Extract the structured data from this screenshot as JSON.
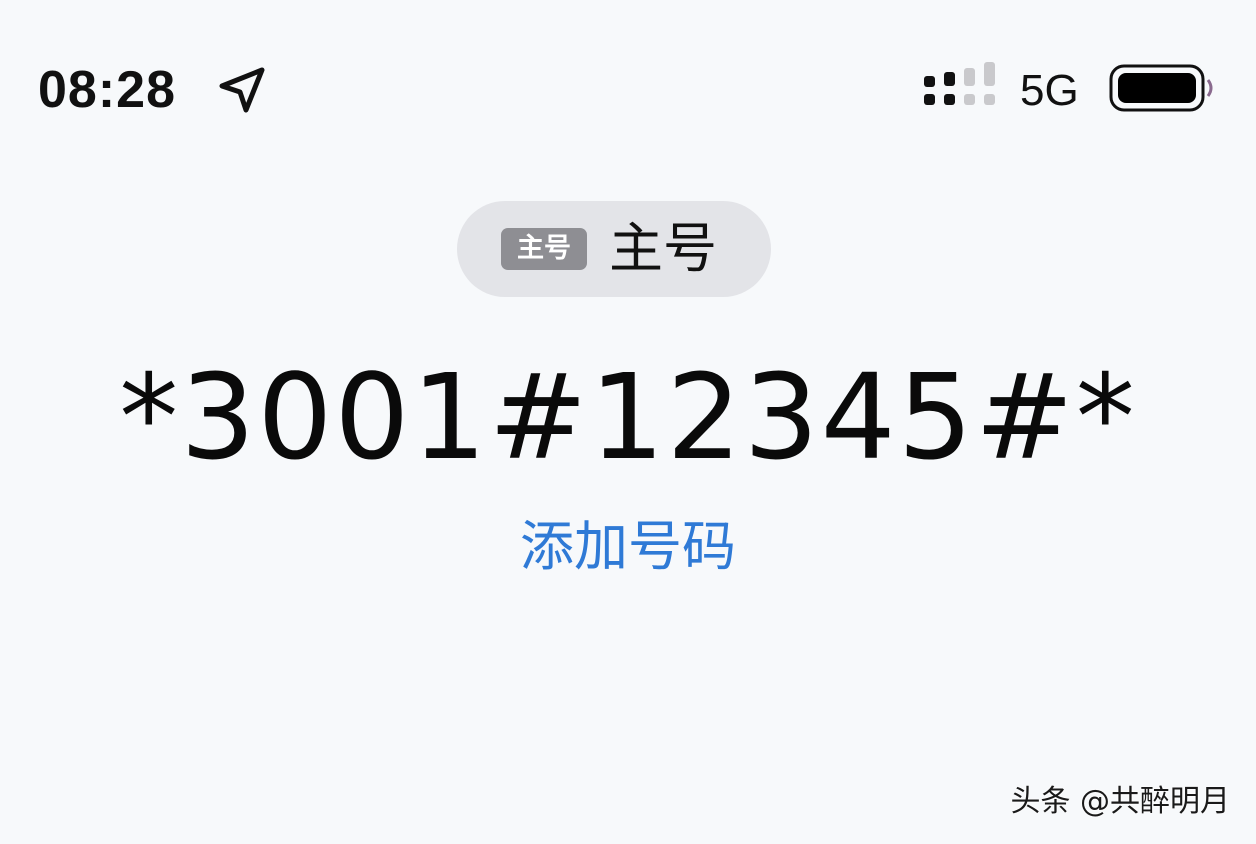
{
  "status_bar": {
    "time": "08:28",
    "network": "5G",
    "icons": {
      "location": "location-arrow-icon",
      "signal": "cellular-signal-icon",
      "battery": "battery-icon"
    },
    "signal_bars_active": 2,
    "signal_bars_total": 4,
    "battery_level": 1.0
  },
  "sim_selector": {
    "badge": "主号",
    "label": "主号"
  },
  "dialer": {
    "number": "*3001#12345#*",
    "add_number_label": "添加号码"
  },
  "watermark": {
    "text": "头条 @共醉明月"
  },
  "colors": {
    "background": "#f7f9fb",
    "link": "#2f7ad6",
    "pill": "#e3e4e8",
    "badge": "#8e8e93"
  }
}
